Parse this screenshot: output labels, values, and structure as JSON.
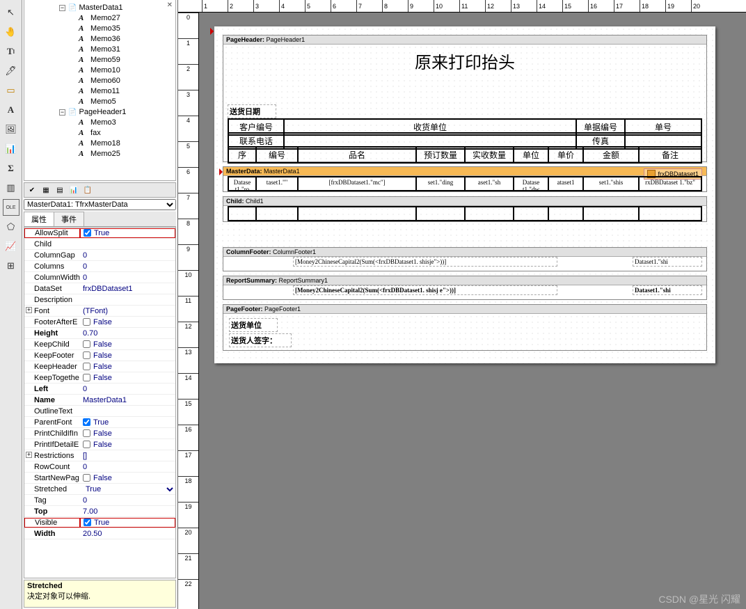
{
  "tree": {
    "root": "MasterData1",
    "memos_md": [
      "Memo27",
      "Memo35",
      "Memo36",
      "Memo31",
      "Memo59",
      "Memo10",
      "Memo60",
      "Memo11",
      "Memo5"
    ],
    "ph": "PageHeader1",
    "memos_ph": [
      "Memo3",
      "fax",
      "Memo18",
      "Memo25"
    ]
  },
  "object_selector": "MasterData1: TfrxMasterData",
  "tabs": {
    "t1": "属性",
    "t2": "事件"
  },
  "props": [
    {
      "n": "AllowSplit",
      "v": "True",
      "cb": true,
      "hl": true
    },
    {
      "n": "Child",
      "v": ""
    },
    {
      "n": "ColumnGap",
      "v": "0"
    },
    {
      "n": "Columns",
      "v": "0"
    },
    {
      "n": "ColumnWidth",
      "v": "0"
    },
    {
      "n": "DataSet",
      "v": "frxDBDataset1"
    },
    {
      "n": "Description",
      "v": ""
    },
    {
      "n": "Font",
      "v": "(TFont)",
      "exp": "+"
    },
    {
      "n": "FooterAfterE",
      "v": "False",
      "cb": false
    },
    {
      "n": "Height",
      "v": "0.70",
      "bold": true
    },
    {
      "n": "KeepChild",
      "v": "False",
      "cb": false
    },
    {
      "n": "KeepFooter",
      "v": "False",
      "cb": false
    },
    {
      "n": "KeepHeader",
      "v": "False",
      "cb": false
    },
    {
      "n": "KeepTogethe",
      "v": "False",
      "cb": false
    },
    {
      "n": "Left",
      "v": "0",
      "bold": true
    },
    {
      "n": "Name",
      "v": "MasterData1",
      "bold": true
    },
    {
      "n": "OutlineText",
      "v": ""
    },
    {
      "n": "ParentFont",
      "v": "True",
      "cb": true
    },
    {
      "n": "PrintChildIfIn",
      "v": "False",
      "cb": false
    },
    {
      "n": "PrintIfDetailE",
      "v": "False",
      "cb": false
    },
    {
      "n": "Restrictions",
      "v": "[]",
      "exp": "+"
    },
    {
      "n": "RowCount",
      "v": "0"
    },
    {
      "n": "StartNewPag",
      "v": "False",
      "cb": false
    },
    {
      "n": "Stretched",
      "v": "True",
      "combo": true
    },
    {
      "n": "Tag",
      "v": "0"
    },
    {
      "n": "Top",
      "v": "7.00",
      "bold": true
    },
    {
      "n": "Visible",
      "v": "True",
      "cb": true,
      "hl": true
    },
    {
      "n": "Width",
      "v": "20.50",
      "bold": true
    }
  ],
  "desc": {
    "title": "Stretched",
    "text": "决定对象可以伸缩."
  },
  "ruler_h": [
    "1",
    "2",
    "3",
    "4",
    "5",
    "6",
    "7",
    "8",
    "9",
    "10",
    "11",
    "12",
    "13",
    "14",
    "15",
    "16",
    "17",
    "18",
    "19",
    "20"
  ],
  "ruler_v": [
    "0",
    "1",
    "2",
    "3",
    "4",
    "5",
    "6",
    "7",
    "8",
    "9",
    "10",
    "11",
    "12",
    "13",
    "14",
    "15",
    "16",
    "17",
    "18",
    "19",
    "20",
    "21",
    "22"
  ],
  "bands": {
    "ph": {
      "label": "PageHeader:",
      "name": "PageHeader1"
    },
    "md": {
      "label": "MasterData:",
      "name": "MasterData1",
      "ds": "frxDBDataset1"
    },
    "child": {
      "label": "Child:",
      "name": "Child1"
    },
    "cf": {
      "label": "ColumnFooter:",
      "name": "ColumnFooter1"
    },
    "rs": {
      "label": "ReportSummary:",
      "name": "ReportSummary1"
    },
    "pf": {
      "label": "PageFooter:",
      "name": "PageFooter1"
    }
  },
  "layout": {
    "title": "原来打印抬头",
    "delivery_date": "送货日期",
    "row1": {
      "c1": "客户编号",
      "c2": "收货单位",
      "c3": "单据编号",
      "c4": "单号"
    },
    "row2": {
      "c1": "联系电话",
      "c2": "传真"
    },
    "hdr": [
      "序",
      "编号",
      "品名",
      "预订数量",
      "实收数量",
      "单位",
      "单价",
      "金额",
      "备注"
    ],
    "md_row": [
      "Datase\nt1.\"ro",
      "taset1.\"\"",
      "[frxDBDataset1.\"mc\"]",
      "set1.\"ding",
      "aset1.\"sh",
      "Datase\nt1.\"dw",
      "ataset1",
      "set1.\"shis",
      "rxDBDataset\n1.\"bz\""
    ],
    "cf_text": "[Money2ChineseCapital2(Sum(<frxDBDataset1. shisje\">))]",
    "cf_right": "Dataset1.\"shi",
    "rs_text": "[Money2ChineseCapital2(Sum(<frxDBDataset1. shisj\ne\">))]",
    "rs_right": "Dataset1.\"shi",
    "pf1": "送货单位",
    "pf2": "送货人签字："
  },
  "chart_data": null,
  "toolbox": [
    "pointer",
    "hand",
    "text-tool",
    "format-brush",
    "erase",
    "text-a",
    "picture",
    "layout",
    "sigma",
    "barcode",
    "ole-object",
    "shape",
    "home"
  ],
  "watermark": "CSDN @星光 闪耀"
}
